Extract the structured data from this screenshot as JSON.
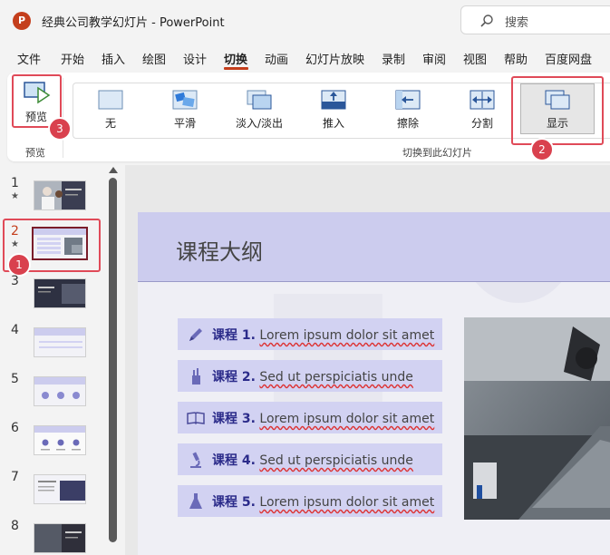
{
  "window": {
    "title": "经典公司教学幻灯片 - PowerPoint",
    "app_logo": "P"
  },
  "search": {
    "placeholder": "搜索"
  },
  "menu": [
    "文件",
    "开始",
    "插入",
    "绘图",
    "设计",
    "切换",
    "动画",
    "幻灯片放映",
    "录制",
    "审阅",
    "视图",
    "帮助",
    "百度网盘"
  ],
  "menu_active": "切换",
  "ribbon": {
    "preview_button": "预览",
    "preview_group": "预览",
    "transitions_group": "切换到此幻灯片",
    "transitions": [
      {
        "label": "无",
        "icon": "none-transition-icon"
      },
      {
        "label": "平滑",
        "icon": "morph-transition-icon"
      },
      {
        "label": "淡入/淡出",
        "icon": "fade-transition-icon"
      },
      {
        "label": "推入",
        "icon": "push-transition-icon"
      },
      {
        "label": "擦除",
        "icon": "wipe-transition-icon"
      },
      {
        "label": "分割",
        "icon": "split-transition-icon"
      },
      {
        "label": "显示",
        "icon": "reveal-transition-icon",
        "selected": true
      }
    ]
  },
  "annotations": [
    "1",
    "2",
    "3"
  ],
  "thumbnails": [
    {
      "number": "1",
      "star": true
    },
    {
      "number": "2",
      "star": true,
      "active": true
    },
    {
      "number": "3"
    },
    {
      "number": "4"
    },
    {
      "number": "5"
    },
    {
      "number": "6"
    },
    {
      "number": "7"
    },
    {
      "number": "8"
    }
  ],
  "slide": {
    "title": "课程大纲",
    "items": [
      {
        "label": "课程 1.",
        "text": "Lorem ipsum dolor sit amet",
        "icon": "pencil-icon"
      },
      {
        "label": "课程 2.",
        "text": "Sed ut perspiciatis unde",
        "icon": "pencil-cup-icon"
      },
      {
        "label": "课程 3.",
        "text": "Lorem ipsum dolor sit amet",
        "icon": "open-book-icon"
      },
      {
        "label": "课程 4.",
        "text": "Sed ut perspiciatis unde",
        "icon": "microscope-icon"
      },
      {
        "label": "课程 5.",
        "text": "Lorem ipsum dolor sit amet",
        "icon": "flask-icon"
      }
    ]
  },
  "colors": {
    "accent": "#c43e1c",
    "highlight": "#e04a58",
    "slide_header": "#ccccee",
    "item_bg": "#d2d2f2",
    "item_label": "#2b2b8a"
  }
}
